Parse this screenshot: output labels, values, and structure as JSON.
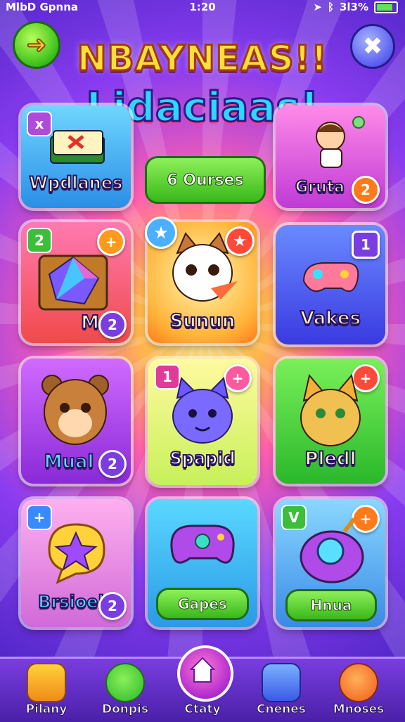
{
  "status_bar": {
    "carrier": "MlbD Gpnna",
    "time": "1:20",
    "battery": "3l3%"
  },
  "header": {
    "title_line1": "NBAYNEAS!!",
    "title_line2": "Lidaciaas!"
  },
  "cards": [
    {
      "label": "Wpdlanes",
      "tag": "x"
    },
    {
      "label": "6 Ourses"
    },
    {
      "label": "Gruta",
      "badge": "2"
    },
    {
      "label": "M",
      "tag": "2",
      "badge": "2",
      "corner_badge": "+"
    },
    {
      "label": "Sunun"
    },
    {
      "label": "Vakes",
      "badge": "1"
    },
    {
      "label": "Mual",
      "badge": "2"
    },
    {
      "label": "Spapid",
      "tag": "1",
      "badge": "+"
    },
    {
      "label": "Pledl",
      "badge": "+"
    },
    {
      "label": "Brsioel",
      "tag": "+",
      "badge": "2"
    },
    {
      "label": "Gapes"
    },
    {
      "label": "Hnua",
      "tag": "V",
      "badge": "+"
    }
  ],
  "bottom_nav": [
    {
      "label": "Pilany"
    },
    {
      "label": "Donpis"
    },
    {
      "label": "Ctaty"
    },
    {
      "label": "Cnenes"
    },
    {
      "label": "Mnoses"
    }
  ]
}
